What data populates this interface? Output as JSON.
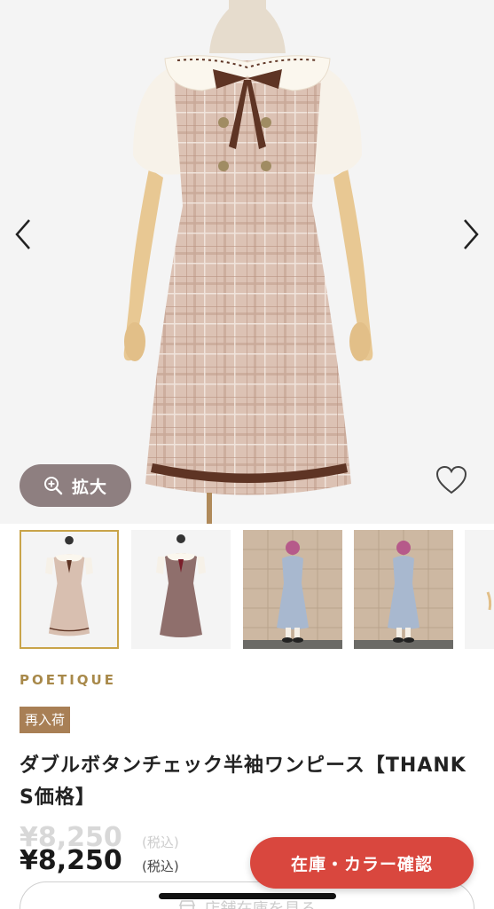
{
  "gallery": {
    "prev_icon": "chevron-left-icon",
    "next_icon": "chevron-right-icon",
    "zoom_label": "拡大",
    "zoom_icon": "zoom-in-icon",
    "favorite_icon": "heart-outline-icon"
  },
  "thumbnails": [
    {
      "name": "beige-dress-front",
      "selected": true
    },
    {
      "name": "brown-dress-front",
      "selected": false
    },
    {
      "name": "blue-dress-model",
      "selected": false
    },
    {
      "name": "blue-dress-model-2",
      "selected": false
    },
    {
      "name": "partial-thumbnail",
      "selected": false
    }
  ],
  "product": {
    "brand": "POETIQUE",
    "badge": "再入荷",
    "name": "ダブルボタンチェック半袖ワンピース【THANKS価格】",
    "price_old": "¥8,250",
    "price_old_tax": "(税込)",
    "price": "¥8,250",
    "price_tax": "(税込)"
  },
  "actions": {
    "stock_color_label": "在庫・カラー確認",
    "store_stock_label": "店舗在庫を見る"
  },
  "colors": {
    "brand_gold": "#a8894a",
    "badge_brown": "#a87f55",
    "cta_red": "#d9473e",
    "zoom_gray": "#8e7f80"
  }
}
